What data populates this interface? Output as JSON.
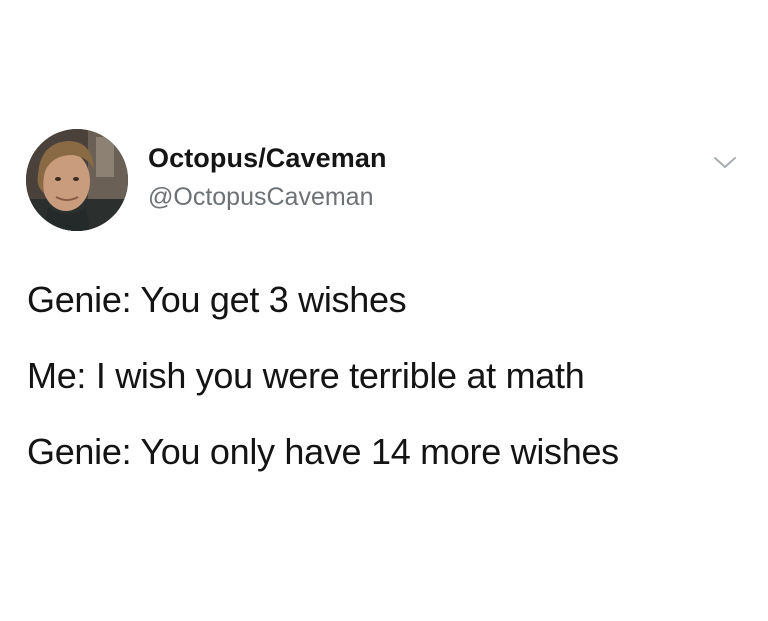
{
  "author": {
    "display_name": "Octopus/Caveman",
    "handle": "@OctopusCaveman",
    "avatar_icon": "profile-photo",
    "menu_icon": "chevron-down-icon"
  },
  "tweet": {
    "lines": [
      "Genie: You get 3 wishes",
      "Me: I wish you were terrible at math",
      "Genie: You only have 14 more wishes"
    ]
  },
  "colors": {
    "background": "#ffffff",
    "name_text": "#151515",
    "handle_text": "#6d7276",
    "body_text": "#141414",
    "chevron": "#a7adb2"
  }
}
